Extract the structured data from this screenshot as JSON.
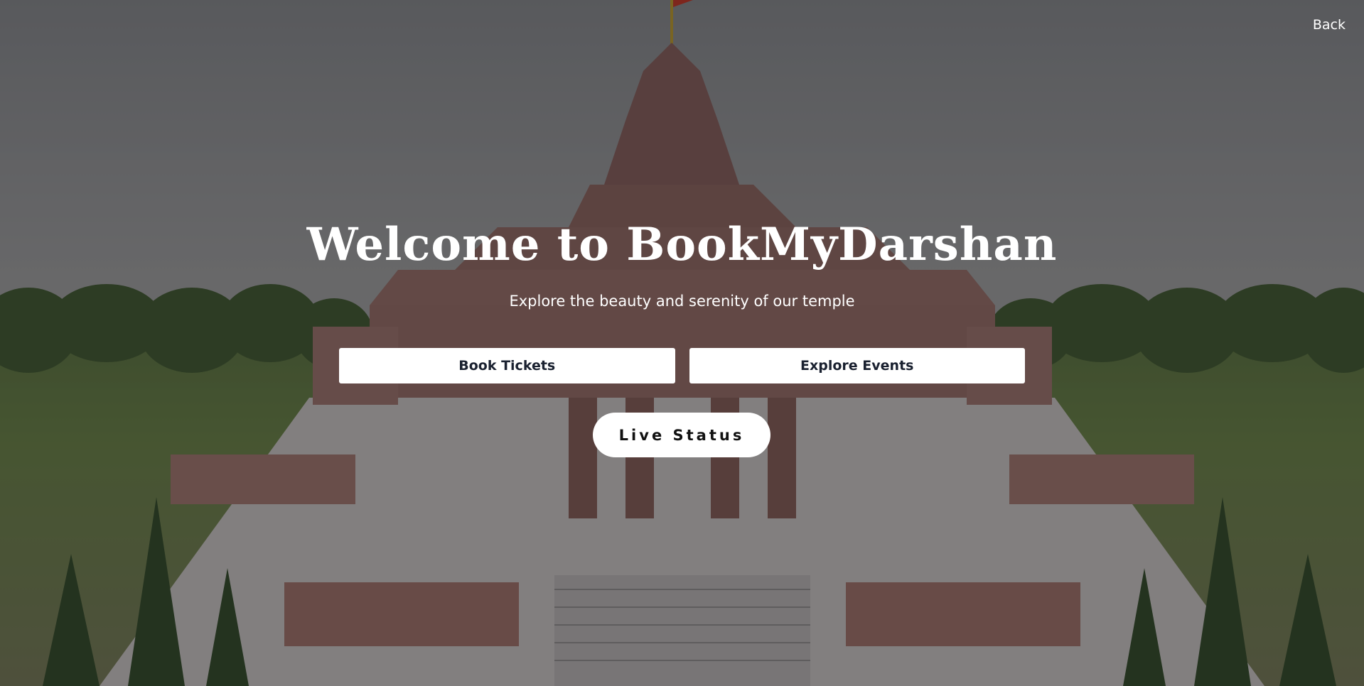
{
  "nav": {
    "back_label": "Back"
  },
  "hero": {
    "title": "Welcome to BookMyDarshan",
    "subtitle": "Explore the beauty and serenity of our temple"
  },
  "actions": {
    "book_tickets_label": "Book Tickets",
    "explore_events_label": "Explore Events",
    "live_status_label": "Live Status"
  },
  "colors": {
    "overlay": "#19191c",
    "button_bg": "#ffffff",
    "button_text": "#1a2130",
    "temple_stone": "#9a6f66",
    "flag": "#d2321e"
  },
  "background": {
    "icon": "temple-illustration"
  }
}
